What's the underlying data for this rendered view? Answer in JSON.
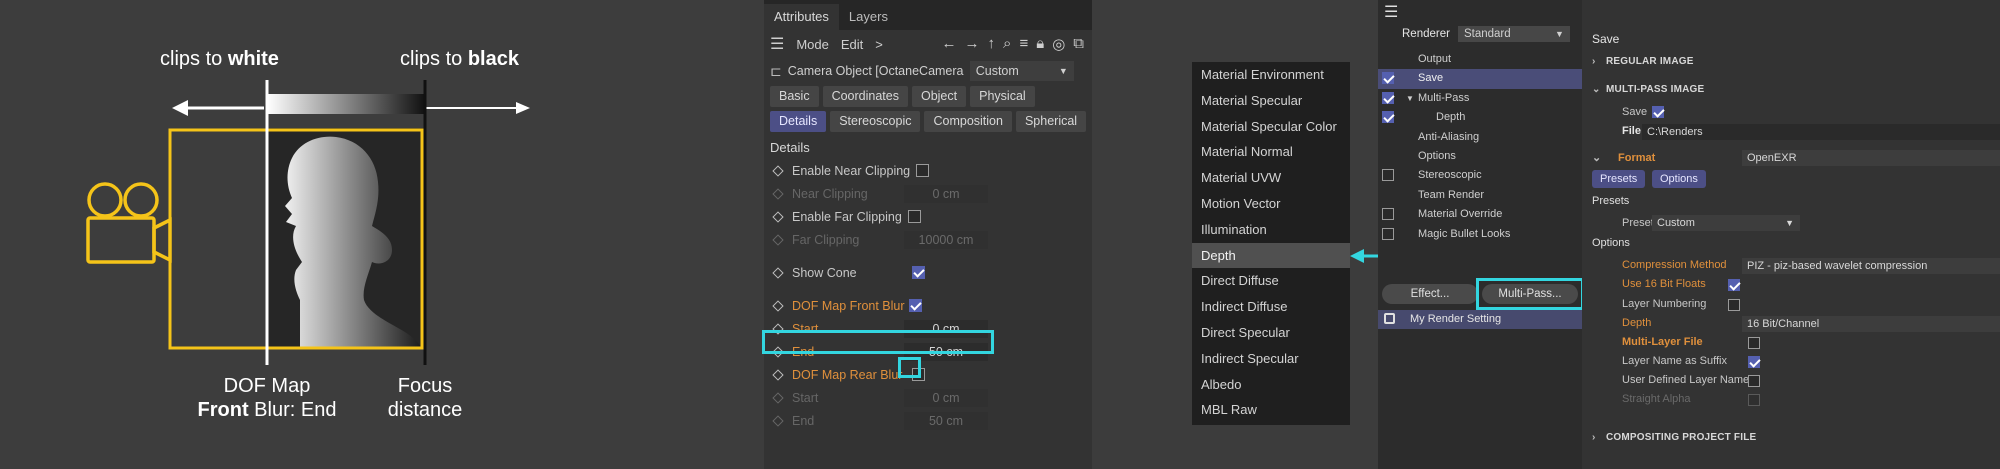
{
  "diagram": {
    "left_label_pre": "clips to ",
    "left_label_bold": "white",
    "right_label_pre": "clips to ",
    "right_label_bold": "black",
    "dof_label_line1": "DOF Map",
    "dof_label_bold": "Front",
    "dof_label_rest": " Blur: End",
    "focus_line1": "Focus",
    "focus_line2": "distance",
    "colors": {
      "camera": "#f5c419",
      "frame": "#f5c419",
      "arrow": "#ffffff"
    },
    "icons": [
      "camera-icon",
      "silhouette-icon"
    ]
  },
  "attributes": {
    "tabs": [
      "Attributes",
      "Layers"
    ],
    "menu": [
      "Mode",
      "Edit"
    ],
    "menu_more": ">",
    "toolbar_icons": [
      "back-arrow-icon",
      "forward-arrow-icon",
      "up-arrow-icon",
      "search-icon",
      "filter-icon",
      "lock-icon",
      "target-icon",
      "new-window-icon"
    ],
    "object_title": "Camera Object [OctaneCamera -...",
    "object_preset": "Custom",
    "tab_buttons_row1": [
      "Basic",
      "Coordinates",
      "Object",
      "Physical"
    ],
    "tab_buttons_row2": [
      "Details",
      "Stereoscopic",
      "Composition",
      "Spherical"
    ],
    "section": "Details",
    "params": {
      "enable_near": "Enable Near Clipping",
      "near_clipping": "Near Clipping",
      "near_value": "0 cm",
      "enable_far": "Enable Far Clipping",
      "far_clipping": "Far Clipping",
      "far_value": "10000 cm",
      "show_cone": "Show Cone",
      "front_blur": "DOF Map Front Blur",
      "start": "Start",
      "front_start": "0 cm",
      "end": "End",
      "front_end": "50 cm",
      "rear_blur": "DOF Map Rear Blur",
      "rear_start_label": "Start",
      "rear_start": "0 cm",
      "rear_end_label": "End",
      "rear_end": "50 cm"
    },
    "highlight_color": "#33d6e0"
  },
  "menu_list": {
    "items": [
      "Material Environment",
      "Material Specular",
      "Material Specular Color",
      "Material Normal",
      "Material UVW",
      "Motion Vector",
      "Illumination",
      "Depth",
      "Direct Diffuse",
      "Indirect Diffuse",
      "Direct Specular",
      "Indirect Specular",
      "Albedo",
      "MBL Raw"
    ],
    "selected": "Depth"
  },
  "render_settings": {
    "renderer_label": "Renderer",
    "renderer_value": "Standard",
    "tree": {
      "output": "Output",
      "save": "Save",
      "multipass": "Multi-Pass",
      "depth": "Depth",
      "anti_aliasing": "Anti-Aliasing",
      "options": "Options",
      "stereoscopic": "Stereoscopic",
      "team_render": "Team Render",
      "material_override": "Material Override",
      "magic_bullet": "Magic Bullet Looks"
    },
    "effect_button": "Effect...",
    "multipass_button": "Multi-Pass...",
    "my_render_setting": "My Render Setting",
    "panel_title": "Save",
    "regular_image": "REGULAR IMAGE",
    "multipass_image": "MULTI-PASS IMAGE",
    "save_label": "Save",
    "file_label": "File",
    "file_value": "C:\\Renders",
    "format_label": "Format",
    "format_value": "OpenEXR",
    "presets_btn": "Presets",
    "options_btn": "Options",
    "presets_header": "Presets",
    "presets_label": "Presets",
    "presets_value": "Custom",
    "options_header": "Options",
    "compression_label": "Compression Method",
    "compression_value": "PIZ - piz-based wavelet compression",
    "use16_label": "Use 16 Bit Floats",
    "layer_numbering": "Layer Numbering",
    "depth_label": "Depth",
    "depth_value": "16 Bit/Channel",
    "multilayer_label": "Multi-Layer File",
    "layer_suffix": "Layer Name as Suffix",
    "user_layer": "User Defined Layer Name",
    "straight_alpha": "Straight Alpha",
    "compositing": "COMPOSITING PROJECT FILE"
  }
}
